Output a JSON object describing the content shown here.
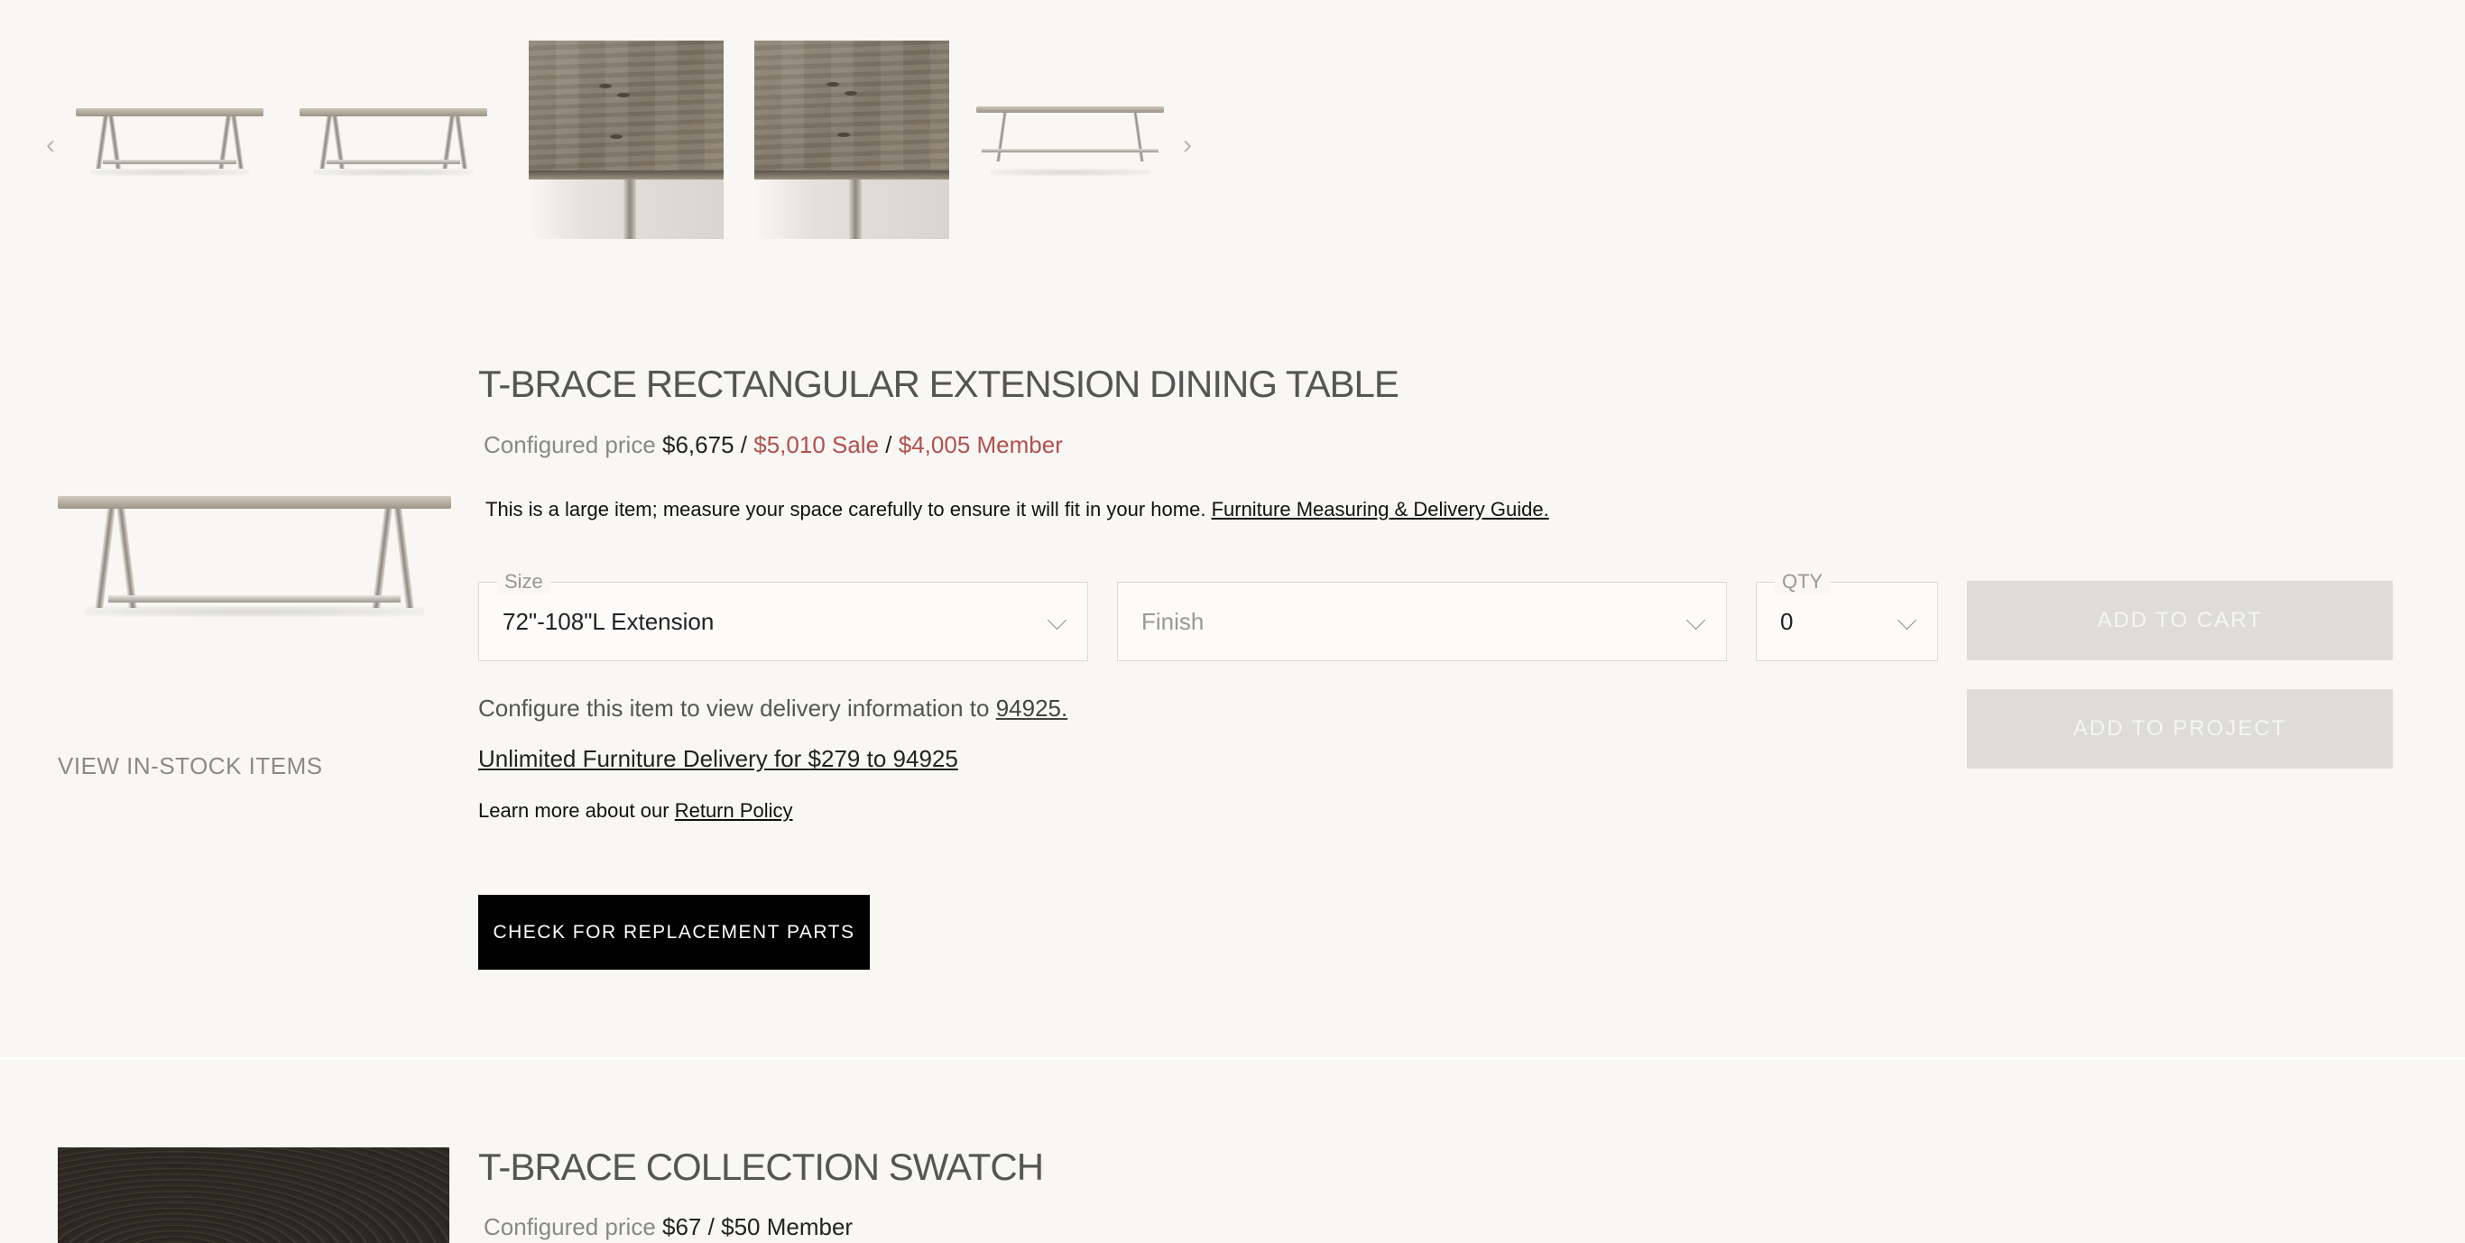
{
  "carousel": {
    "prev_icon": "chevron-left-icon",
    "next_icon": "chevron-right-icon",
    "prev_glyph": "‹",
    "next_glyph": "›"
  },
  "product": {
    "title": "T-BRACE RECTANGULAR EXTENSION DINING TABLE",
    "price_label": "Configured price",
    "price_regular": "$6,675",
    "price_sale": "$5,010 Sale",
    "price_member": "$4,005 Member",
    "separator": "/",
    "note_text": "This is a large item; measure your space carefully to ensure it will fit in your home.",
    "note_link": "Furniture Measuring & Delivery Guide.",
    "view_in_stock": "VIEW IN-STOCK ITEMS",
    "size": {
      "label": "Size",
      "value": "72\"-108\"L Extension"
    },
    "finish": {
      "placeholder": "Finish"
    },
    "qty": {
      "label": "QTY",
      "value": "0"
    },
    "add_to_cart": "ADD TO CART",
    "add_to_project": "ADD TO PROJECT",
    "delivery_text": "Configure this item to view delivery information to",
    "delivery_zip": "94925.",
    "unlimited_delivery": "Unlimited Furniture Delivery for $279 to 94925",
    "returns_text": "Learn more about our",
    "returns_link": "Return Policy",
    "replacement_parts": "CHECK FOR REPLACEMENT PARTS",
    "colors": {
      "sale": "#b2504d",
      "button_dark": "#000000",
      "button_disabled": "#dddcda"
    }
  },
  "swatch_product": {
    "title": "T-BRACE COLLECTION SWATCH",
    "price_label": "Configured price",
    "price_regular": "$67",
    "separator": "/",
    "price_member": "$50 Member"
  }
}
